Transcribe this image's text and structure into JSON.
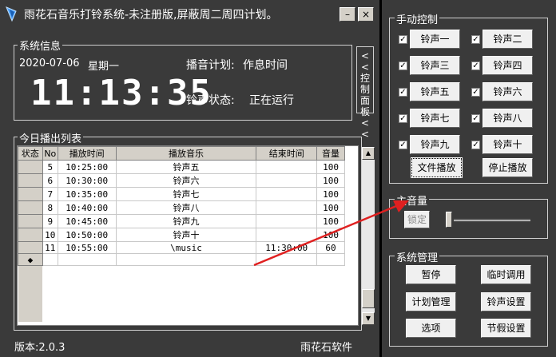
{
  "title": "雨花石音乐打铃系统-未注册版,屏蔽周二周四计划。",
  "window_controls": {
    "minimize": "–",
    "close": "×"
  },
  "system_info": {
    "label": "系统信息",
    "date": "2020-07-06",
    "weekday": "星期一",
    "plan_label": "播音计划:",
    "plan_value": "作息时间",
    "clock": "11:13:35",
    "bell_status_label": "铃声状态:",
    "bell_status_value": "正在运行"
  },
  "control_panel_tab": "<<控制面板<<",
  "today_list": {
    "label": "今日播出列表",
    "columns": [
      "状态",
      "No",
      "播放时间",
      "播放音乐",
      "结束时间",
      "音量"
    ],
    "rows": [
      {
        "status": "",
        "no": "5",
        "time": "10:25:00",
        "music": "铃声五",
        "end": "",
        "volume": "100"
      },
      {
        "status": "",
        "no": "6",
        "time": "10:30:00",
        "music": "铃声六",
        "end": "",
        "volume": "100"
      },
      {
        "status": "",
        "no": "7",
        "time": "10:35:00",
        "music": "铃声七",
        "end": "",
        "volume": "100"
      },
      {
        "status": "",
        "no": "8",
        "time": "10:40:00",
        "music": "铃声八",
        "end": "",
        "volume": "100"
      },
      {
        "status": "",
        "no": "9",
        "time": "10:45:00",
        "music": "铃声九",
        "end": "",
        "volume": "100"
      },
      {
        "status": "",
        "no": "10",
        "time": "10:50:00",
        "music": "铃声十",
        "end": "",
        "volume": "100"
      },
      {
        "status": "",
        "no": "11",
        "time": "10:55:00",
        "music": "\\music",
        "end": "11:30:00",
        "volume": "60"
      },
      {
        "status": "◆",
        "no": "",
        "time": "",
        "music": "",
        "end": "",
        "volume": ""
      }
    ]
  },
  "footer": {
    "version": "版本:2.0.3",
    "company": "雨花石软件"
  },
  "manual_control": {
    "label": "手动控制",
    "bells": [
      "铃声一",
      "铃声二",
      "铃声三",
      "铃声四",
      "铃声五",
      "铃声六",
      "铃声七",
      "铃声八",
      "铃声九",
      "铃声十"
    ],
    "file_play": "文件播放",
    "stop_play": "停止播放"
  },
  "master_volume": {
    "label": "主音量",
    "lock": "锁定"
  },
  "system_management": {
    "label": "系统管理",
    "pause": "暂停",
    "temp_call": "临时调用",
    "plan_manage": "计划管理",
    "bell_settings": "铃声设置",
    "options": "选项",
    "holiday_settings": "节假设置"
  },
  "colors": {
    "panel": "#3a3a3a",
    "arrow": "#e02020",
    "window_bg": "#000000"
  }
}
